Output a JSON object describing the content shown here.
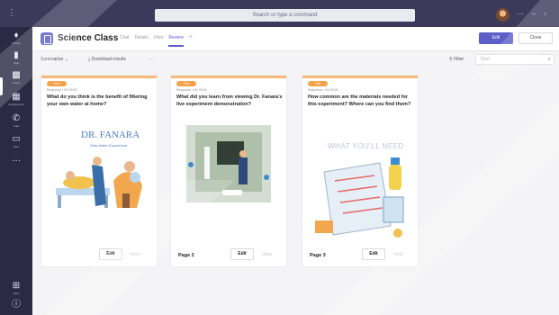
{
  "titlebar": {
    "search_placeholder": "Search or type a command"
  },
  "rail": {
    "items": [
      {
        "icon": "bell-icon",
        "label": "Activity"
      },
      {
        "icon": "chat-icon",
        "label": "Chat"
      },
      {
        "icon": "teams-icon",
        "label": "Teams"
      },
      {
        "icon": "assignments-icon",
        "label": "Assignments"
      },
      {
        "icon": "calls-icon",
        "label": "Calls"
      },
      {
        "icon": "files-icon",
        "label": "Files"
      },
      {
        "icon": "more-icon",
        "label": ""
      },
      {
        "icon": "apps-icon",
        "label": "Apps"
      },
      {
        "icon": "help-icon",
        "label": "Help"
      }
    ]
  },
  "header": {
    "team_name": "Science Class",
    "tabs": [
      "Chat",
      "Details",
      "Files",
      "Review"
    ],
    "active_tab": "Review",
    "edit_label": "Edit",
    "close_label": "Close"
  },
  "toolbar": {
    "sort_label": "Summarize",
    "download_label": "Download results",
    "more_label": "···",
    "filter_label": "Filter",
    "search_placeholder": "Find"
  },
  "cards": [
    {
      "badge": "Poll",
      "meta": "Response • 0/0 00:00",
      "question": "What do you think is the benefit of filtering your own water at home?",
      "brand": "DR. FANARA",
      "subtitle": "Dirty Water Experiment",
      "page": "",
      "edit": "Edit",
      "view": "View"
    },
    {
      "badge": "Poll",
      "meta": "Response • 0/0 00:00",
      "question": "What did you learn from viewing Dr. Fanara's live experiment demonstration?",
      "page": "Page 2",
      "edit": "Edit",
      "view": "View"
    },
    {
      "badge": "Poll",
      "meta": "Response • 0/0 00:00",
      "question": "How common are the materials needed for this experiment? Where can you find them?",
      "heading": "WHAT YOU'LL NEED",
      "page": "Page 3",
      "edit": "Edit",
      "view": "View"
    }
  ],
  "colors": {
    "accent": "#5b5fc7",
    "badge": "#f5a34b",
    "rail": "#2b2a45"
  }
}
